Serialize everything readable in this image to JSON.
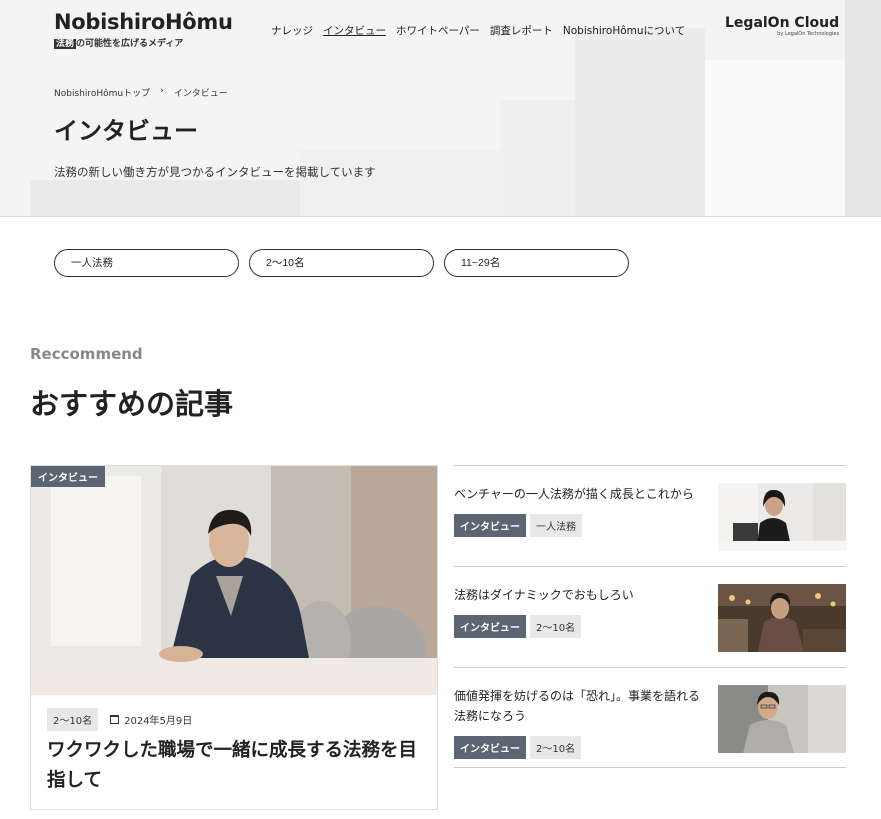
{
  "header": {
    "logo_title": "NobishiroHômu",
    "logo_sub_highlight": "法務",
    "logo_sub_rest": "の可能性を広げるメディア",
    "nav": [
      "ナレッジ",
      "インタビュー",
      "ホワイトペーパー",
      "調査レポート",
      "NobishiroHômuについて"
    ],
    "brand": "LegalOn Cloud",
    "brand_by": "by LegalOn Technologies"
  },
  "breadcrumb": {
    "home": "NobishiroHômuトップ",
    "separator": "›",
    "current": "インタビュー"
  },
  "page": {
    "title": "インタビュー",
    "lead": "法務の新しい働き方が見つかるインタビューを掲載しています"
  },
  "filters": [
    "一人法務",
    "2〜10名",
    "11~29名"
  ],
  "recommend": {
    "eyebrow": "Reccommend",
    "title": "おすすめの記事"
  },
  "main_article": {
    "category": "インタビュー",
    "tag": "2〜10名",
    "date": "2024年5月9日",
    "title": "ワクワクした職場で一緒に成長する法務を目指して"
  },
  "side_articles": [
    {
      "title": "ベンチャーの一人法務が描く成長とこれから",
      "category": "インタビュー",
      "tag": "一人法務"
    },
    {
      "title": "法務はダイナミックでおもしろい",
      "category": "インタビュー",
      "tag": "2〜10名"
    },
    {
      "title": "価値発揮を妨げるのは「恐れ」。事業を語れる法務になろう",
      "category": "インタビュー",
      "tag": "2〜10名"
    }
  ],
  "colors": {
    "category_tag": "#5c6572",
    "hero_bg": "#f4f4f4"
  }
}
